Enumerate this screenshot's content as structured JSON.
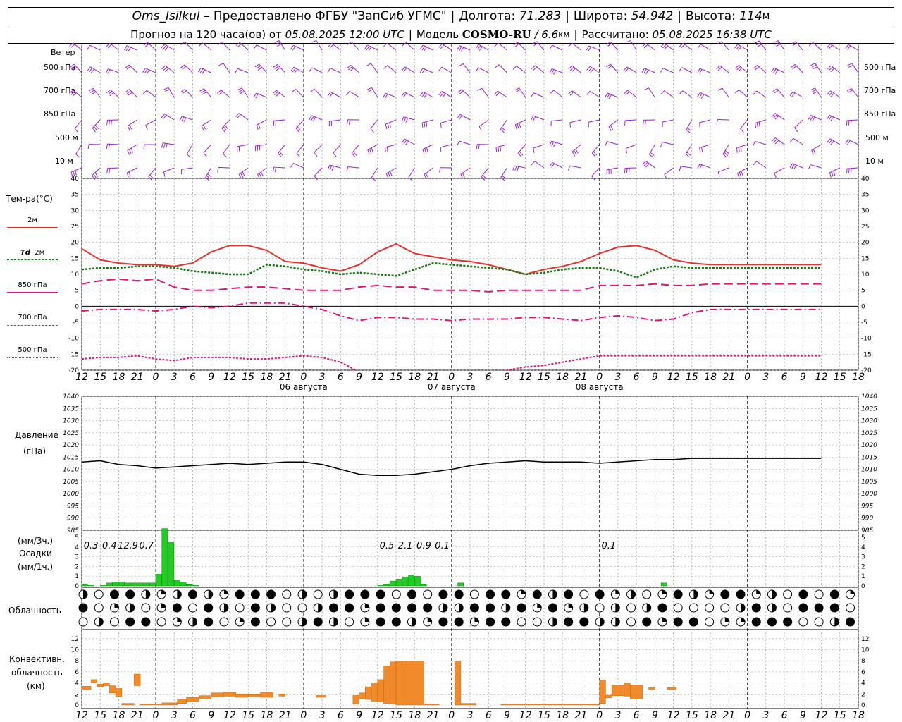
{
  "header": {
    "station": "Oms_Isilkul",
    "provider": "– Предоставлено ФГБУ \"ЗапСиб УГМС\"",
    "lon_label": "Долгота:",
    "lon": "71.283",
    "lat_label": "Широта:",
    "lat": "54.942",
    "alt_label": "Высота:",
    "alt": "114",
    "alt_unit": "м",
    "forecast_label": "Прогноз на 120 часа(ов) от",
    "forecast_from": "05.08.2025 12:00 UTC",
    "model_label": "Модель",
    "model": "COSMO-RU",
    "model_res": "/ 6.6",
    "model_res_unit": "км",
    "calc_label": "Рассчитано:",
    "calc_time": "05.08.2025 16:38 UTC"
  },
  "labels": {
    "wind": "Ветер",
    "wind_levels": [
      "500 гПа",
      "700 гПа",
      "850 гПа",
      "500 м",
      "10  м"
    ],
    "temp_title": "Тем-ра(°C)",
    "temp_2m": "2м",
    "td_2m_a": "Td",
    "td_2m_b": "2м",
    "t850": "850 гПа",
    "t700": "700 гПа",
    "t500": "500 гПа",
    "pressure_a": "Давление",
    "pressure_b": "(гПа)",
    "precip_a": "(мм/3ч.)",
    "precip_b": "Осадки",
    "precip_c": "(мм/1ч.)",
    "cloud": "Облачность",
    "conv_a": "Конвективн.",
    "conv_b": "облачность",
    "conv_c": "(км)"
  },
  "dates": [
    "06 августа",
    "07 августа",
    "08 августа"
  ],
  "colors": {
    "wind": "#9a1fd8",
    "t2m": "#e8322e",
    "td2m": "#117a11",
    "tlevels": "#e0147e",
    "pressure": "#000000",
    "precip": "#22cc22",
    "conv": "#f08a2a"
  },
  "chart_data": [
    {
      "type": "line",
      "name": "temperature",
      "x_hours": [
        0,
        3,
        6,
        9,
        12,
        15,
        18,
        21,
        24,
        27,
        30,
        33,
        36,
        39,
        42,
        45,
        48,
        51,
        54,
        57,
        60,
        63,
        66,
        69,
        72,
        75,
        78,
        81,
        84,
        87,
        90,
        93,
        96,
        99,
        102,
        105,
        108,
        111,
        114,
        117,
        120
      ],
      "x_tick_labels": [
        "12",
        "15",
        "18",
        "21",
        "0",
        "3",
        "6",
        "9",
        "12",
        "15",
        "18",
        "21",
        "0",
        "3",
        "6",
        "9",
        "12",
        "15",
        "18",
        "21",
        "0",
        "3",
        "6",
        "9",
        "12",
        "15",
        "18",
        "21",
        "0",
        "3",
        "6",
        "9",
        "12",
        "15",
        "18",
        "21",
        "0",
        "3",
        "6",
        "9",
        "12",
        "15",
        "18"
      ],
      "ylim": [
        -20,
        40
      ],
      "y_ticks": [
        -20,
        -15,
        -10,
        -5,
        0,
        5,
        10,
        15,
        20,
        25,
        30,
        35,
        40
      ],
      "series": [
        {
          "name": "2м",
          "values": [
            18,
            14.5,
            13.5,
            13,
            13,
            12.5,
            13.5,
            17,
            19,
            19,
            17.5,
            14,
            13.5,
            12,
            11,
            13,
            17,
            19.5,
            16.5,
            15.5,
            14.5,
            14,
            13,
            11.5,
            10,
            11.5,
            12.5,
            14,
            16.5,
            18.5,
            19,
            17.5,
            14.5,
            13.5,
            13,
            13,
            13,
            13,
            13,
            13,
            13
          ]
        },
        {
          "name": "Td 2м",
          "values": [
            11.5,
            12,
            12,
            12.5,
            12.5,
            12,
            11,
            10.5,
            10,
            10,
            13,
            12.5,
            11.5,
            11,
            10,
            10.5,
            10,
            9.5,
            11.5,
            13.5,
            13,
            12.5,
            12,
            11.5,
            10,
            10.5,
            11.5,
            12,
            12,
            11,
            9,
            11.5,
            12.5,
            12,
            12,
            12,
            12,
            12,
            12,
            12,
            12
          ]
        },
        {
          "name": "850 гПа",
          "values": [
            7,
            8,
            8.5,
            8,
            8.5,
            6,
            5,
            5,
            5.5,
            6,
            6,
            5.5,
            5,
            5,
            5,
            6,
            6.5,
            6,
            6,
            5,
            5,
            5,
            4.5,
            5,
            5,
            5,
            5,
            5,
            6.5,
            6.5,
            6.5,
            7,
            6.5,
            6.5,
            7,
            7,
            7,
            7,
            7,
            7,
            7
          ]
        },
        {
          "name": "700 гПа",
          "values": [
            -1.5,
            -1,
            -1,
            -1,
            -1.5,
            -1,
            0,
            -0.5,
            0,
            1,
            1,
            1,
            0,
            -1,
            -3,
            -4.5,
            -3.5,
            -3.5,
            -4,
            -4,
            -4.5,
            -4,
            -4,
            -4,
            -3.5,
            -3.5,
            -4,
            -4.5,
            -3.5,
            -3,
            -3.5,
            -4.5,
            -4,
            -2,
            -1,
            -1,
            -1,
            -1,
            -1,
            -1,
            -1
          ]
        },
        {
          "name": "500 гПа",
          "values": [
            -16.5,
            -16,
            -16,
            -15.5,
            -16.5,
            -17,
            -16,
            -16,
            -16,
            -16.5,
            -16.5,
            -16,
            -15.5,
            -16,
            -17.5,
            -20.5,
            -22,
            -22,
            -22,
            -22,
            -22,
            -22,
            -22,
            -20,
            -19,
            -18.5,
            -17.5,
            -16.5,
            -15.5,
            -15.5,
            -15.5,
            -15.5,
            -15.5,
            -15.5,
            -15.5,
            -15.5,
            -15.5,
            -15.5,
            -15.5,
            -15.5,
            -15.5
          ]
        }
      ]
    },
    {
      "type": "line",
      "name": "pressure",
      "ylim": [
        985,
        1040
      ],
      "y_ticks": [
        985,
        990,
        995,
        1000,
        1005,
        1010,
        1015,
        1020,
        1025,
        1030,
        1035,
        1040
      ],
      "x_hours": [
        0,
        3,
        6,
        9,
        12,
        15,
        18,
        21,
        24,
        27,
        30,
        33,
        36,
        39,
        42,
        45,
        48,
        51,
        54,
        57,
        60,
        63,
        66,
        69,
        72,
        75,
        78,
        81,
        84,
        87,
        90,
        93,
        96,
        99,
        102,
        105,
        108,
        111,
        114,
        117,
        120
      ],
      "values": [
        1013,
        1013.5,
        1012,
        1011.5,
        1010.5,
        1011,
        1011.5,
        1012,
        1012.5,
        1012,
        1012.5,
        1013,
        1013,
        1012,
        1010,
        1008,
        1007.5,
        1007.5,
        1008,
        1009,
        1010,
        1011.5,
        1012.5,
        1013,
        1013.5,
        1013,
        1013,
        1013,
        1012.5,
        1013,
        1013.5,
        1014,
        1014,
        1014.5,
        1014.5,
        1014.5,
        1014.5,
        1014.5,
        1014.5,
        1014.5,
        1014.5
      ]
    },
    {
      "type": "bar",
      "name": "precipitation",
      "ylim": [
        0,
        5
      ],
      "y_ticks": [
        0,
        1,
        2,
        3,
        4,
        5
      ],
      "hourly_x": [
        0,
        1,
        2,
        3,
        4,
        5,
        6,
        7,
        8,
        9,
        10,
        11,
        12,
        13,
        14,
        15,
        16,
        17,
        18,
        19,
        20,
        21,
        22,
        23,
        24
      ],
      "hourly_values": [
        0.2,
        0.1,
        0,
        0.1,
        0.3,
        0.4,
        0.4,
        0.3,
        0.3,
        0.3,
        0.3,
        0.3,
        1.2,
        5.9,
        4.5,
        0.6,
        0.4,
        0.2,
        0.1
      ],
      "hourly_late": [
        {
          "h": 48,
          "v": 0.1
        },
        {
          "h": 49,
          "v": 0.2
        },
        {
          "h": 50,
          "v": 0.5
        },
        {
          "h": 51,
          "v": 0.7
        },
        {
          "h": 52,
          "v": 0.9
        },
        {
          "h": 53,
          "v": 1.1
        },
        {
          "h": 54,
          "v": 1.0
        },
        {
          "h": 55,
          "v": 0.2
        },
        {
          "h": 61,
          "v": 0.3
        },
        {
          "h": 94,
          "v": 0.3
        }
      ],
      "sum3h": [
        {
          "h": 1.5,
          "v": "0.3"
        },
        {
          "h": 4.5,
          "v": "0.4"
        },
        {
          "h": 7.5,
          "v": "12.9"
        },
        {
          "h": 10.5,
          "v": "0.7"
        },
        {
          "h": 49.5,
          "v": "0.5"
        },
        {
          "h": 52.5,
          "v": "2.1"
        },
        {
          "h": 55.5,
          "v": "0.9"
        },
        {
          "h": 58.5,
          "v": "0.1"
        },
        {
          "h": 85.5,
          "v": "0.1"
        }
      ]
    },
    {
      "type": "bar",
      "name": "convective_cloud",
      "ylim": [
        0,
        13
      ],
      "y_ticks": [
        0,
        2,
        4,
        6,
        8,
        10,
        12
      ],
      "segments": [
        {
          "h0": 0,
          "h1": 1.5,
          "base": 2.8,
          "top": 3.4
        },
        {
          "h0": 1.5,
          "h1": 2.5,
          "base": 4,
          "top": 4.6
        },
        {
          "h0": 2.5,
          "h1": 3.5,
          "base": 3.3,
          "top": 3.8
        },
        {
          "h0": 3.5,
          "h1": 4.5,
          "base": 3.5,
          "top": 4
        },
        {
          "h0": 4.5,
          "h1": 5.5,
          "base": 2.2,
          "top": 3.5
        },
        {
          "h0": 5.5,
          "h1": 6.5,
          "base": 1.5,
          "top": 3
        },
        {
          "h0": 6.5,
          "h1": 8.5,
          "base": 0,
          "top": 0.3
        },
        {
          "h0": 8.5,
          "h1": 9.5,
          "base": 3.5,
          "top": 5.6
        },
        {
          "h0": 9.5,
          "h1": 13,
          "base": 0,
          "top": 0.2
        },
        {
          "h0": 13,
          "h1": 15.5,
          "base": 0,
          "top": 0.4
        },
        {
          "h0": 15.5,
          "h1": 17,
          "base": 0.3,
          "top": 1.1
        },
        {
          "h0": 17,
          "h1": 19,
          "base": 0.6,
          "top": 1.4
        },
        {
          "h0": 19,
          "h1": 21,
          "base": 1.1,
          "top": 1.7
        },
        {
          "h0": 21,
          "h1": 23,
          "base": 1.5,
          "top": 2.2
        },
        {
          "h0": 23,
          "h1": 25,
          "base": 1.6,
          "top": 2.3
        },
        {
          "h0": 25,
          "h1": 27,
          "base": 1.4,
          "top": 2
        },
        {
          "h0": 27,
          "h1": 29,
          "base": 1.5,
          "top": 2
        },
        {
          "h0": 29,
          "h1": 31,
          "base": 1.4,
          "top": 2.3
        },
        {
          "h0": 32,
          "h1": 33,
          "base": 1.6,
          "top": 2
        },
        {
          "h0": 38,
          "h1": 39.5,
          "base": 1.4,
          "top": 1.8
        },
        {
          "h0": 44,
          "h1": 45,
          "base": 0.2,
          "top": 1.8
        },
        {
          "h0": 45,
          "h1": 46,
          "base": 1.2,
          "top": 2.2
        },
        {
          "h0": 46,
          "h1": 47,
          "base": 1,
          "top": 3.3
        },
        {
          "h0": 47,
          "h1": 48,
          "base": 0.7,
          "top": 4
        },
        {
          "h0": 48,
          "h1": 49,
          "base": 0.6,
          "top": 4.6
        },
        {
          "h0": 49,
          "h1": 50,
          "base": 0.3,
          "top": 7.1
        },
        {
          "h0": 50,
          "h1": 51,
          "base": 0.2,
          "top": 7.8
        },
        {
          "h0": 51,
          "h1": 52,
          "base": 0,
          "top": 8
        },
        {
          "h0": 52,
          "h1": 55.5,
          "base": 0,
          "top": 8
        },
        {
          "h0": 55.5,
          "h1": 58,
          "base": 0,
          "top": 0.2
        },
        {
          "h0": 60.5,
          "h1": 61.5,
          "base": 0,
          "top": 8
        },
        {
          "h0": 61.5,
          "h1": 64,
          "base": 0,
          "top": 0.3
        },
        {
          "h0": 68,
          "h1": 84,
          "base": 0,
          "top": 0.2
        },
        {
          "h0": 84,
          "h1": 85,
          "base": 0.3,
          "top": 4.5
        },
        {
          "h0": 85,
          "h1": 86,
          "base": 1.3,
          "top": 1.9
        },
        {
          "h0": 86,
          "h1": 88,
          "base": 1.7,
          "top": 3.6
        },
        {
          "h0": 88,
          "h1": 89,
          "base": 1.6,
          "top": 4
        },
        {
          "h0": 89,
          "h1": 91,
          "base": 1.1,
          "top": 3.6
        },
        {
          "h0": 92,
          "h1": 93,
          "base": 2.8,
          "top": 3.2
        },
        {
          "h0": 95,
          "h1": 96.5,
          "base": 2.8,
          "top": 3.2
        }
      ]
    }
  ]
}
